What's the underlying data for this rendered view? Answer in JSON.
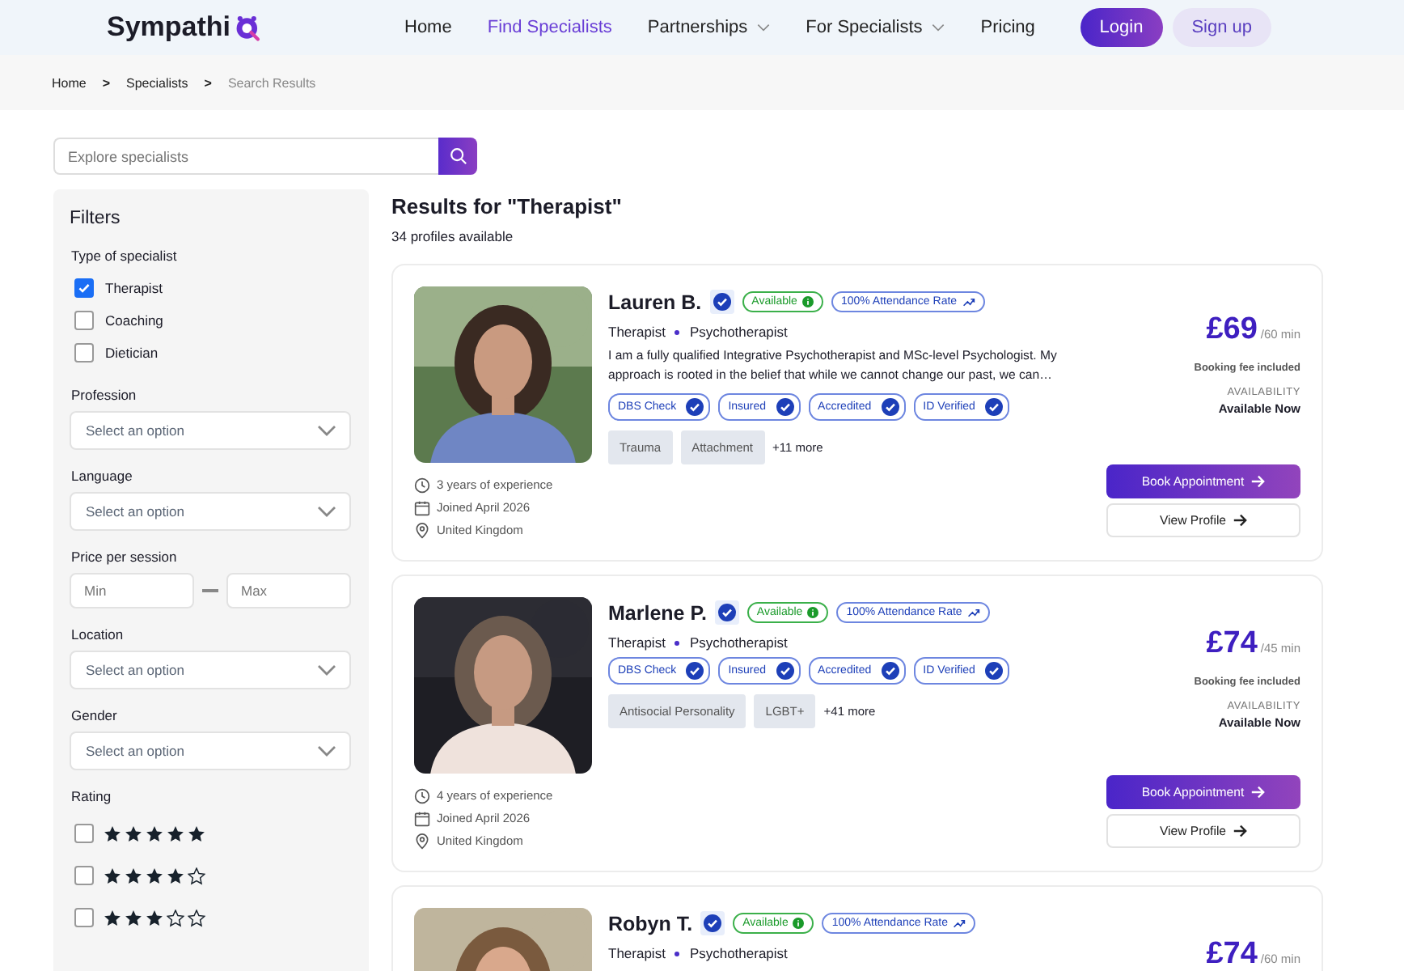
{
  "nav": {
    "logo": "Sympathi",
    "links": [
      {
        "label": "Home",
        "selected": false,
        "dropdown": false
      },
      {
        "label": "Find Specialists",
        "selected": true,
        "dropdown": false
      },
      {
        "label": "Partnerships",
        "selected": false,
        "dropdown": true
      },
      {
        "label": "For Specialists",
        "selected": false,
        "dropdown": true
      },
      {
        "label": "Pricing",
        "selected": false,
        "dropdown": false
      }
    ],
    "login": "Login",
    "signup": "Sign up"
  },
  "breadcrumb": [
    {
      "label": "Home",
      "current": false
    },
    {
      "label": "Specialists",
      "current": false
    },
    {
      "label": "Search Results",
      "current": true
    }
  ],
  "breadcrumb_separator": ">",
  "search": {
    "placeholder": "Explore specialists"
  },
  "filters": {
    "title": "Filters",
    "sections": [
      {
        "kind": "checkboxes",
        "label": "Type of specialist",
        "options": [
          {
            "label": "Therapist",
            "checked": true
          },
          {
            "label": "Coaching",
            "checked": false
          },
          {
            "label": "Dietician",
            "checked": false
          }
        ]
      },
      {
        "kind": "select",
        "label": "Profession",
        "placeholder": "Select an option"
      },
      {
        "kind": "select",
        "label": "Language",
        "placeholder": "Select an option"
      },
      {
        "kind": "range",
        "label": "Price per session",
        "min_placeholder": "Min",
        "max_placeholder": "Max"
      },
      {
        "kind": "select",
        "label": "Location",
        "placeholder": "Select an option"
      },
      {
        "kind": "select",
        "label": "Gender",
        "placeholder": "Select an option"
      },
      {
        "kind": "rating",
        "label": "Rating",
        "options": [
          {
            "stars": 5,
            "checked": false
          },
          {
            "stars": 4,
            "checked": false
          },
          {
            "stars": 3,
            "checked": false
          }
        ]
      }
    ]
  },
  "results": {
    "title": "Results for \"Therapist\"",
    "count": "34 profiles available",
    "cards": [
      {
        "name": "Lauren B.",
        "verified": true,
        "status": "Available",
        "attendance": "100% Attendance Rate",
        "roles": [
          "Therapist",
          "Psychotherapist"
        ],
        "bio": "I am a fully qualified Integrative Psychotherapist and MSc-level Psychologist. My approach is rooted in the belief that while we cannot change our past, we can…",
        "credentials": [
          "DBS Check",
          "Insured",
          "Accredited",
          "ID Verified"
        ],
        "tags": [
          "Trauma",
          "Attachment"
        ],
        "more": "+11 more",
        "meta": [
          {
            "kind": "experience",
            "text": "3 years of experience"
          },
          {
            "kind": "joined",
            "text": "Joined April 2026"
          },
          {
            "kind": "location",
            "text": "United Kingdom"
          }
        ],
        "price": "£69",
        "per": "/60 min",
        "fee": "Booking fee included",
        "availability_label": "AVAILABILITY",
        "availability": "Available Now",
        "book": "Book Appointment",
        "view": "View Profile"
      },
      {
        "name": "Marlene P.",
        "verified": true,
        "status": "Available",
        "attendance": "100% Attendance Rate",
        "roles": [
          "Therapist",
          "Psychotherapist"
        ],
        "credentials": [
          "DBS Check",
          "Insured",
          "Accredited",
          "ID Verified"
        ],
        "tags": [
          "Antisocial Personality",
          "LGBT+"
        ],
        "more": "+41 more",
        "meta": [
          {
            "kind": "experience",
            "text": "4 years of experience"
          },
          {
            "kind": "joined",
            "text": "Joined April 2026"
          },
          {
            "kind": "location",
            "text": "United Kingdom"
          }
        ],
        "price": "£74",
        "per": "/45 min",
        "fee": "Booking fee included",
        "availability_label": "AVAILABILITY",
        "availability": "Available Now",
        "book": "Book Appointment",
        "view": "View Profile"
      },
      {
        "name": "Robyn T.",
        "verified": true,
        "status": "Available",
        "attendance": "100% Attendance Rate",
        "roles": [
          "Therapist",
          "Psychotherapist"
        ],
        "price": "£74",
        "per": "/60 min"
      }
    ]
  }
}
